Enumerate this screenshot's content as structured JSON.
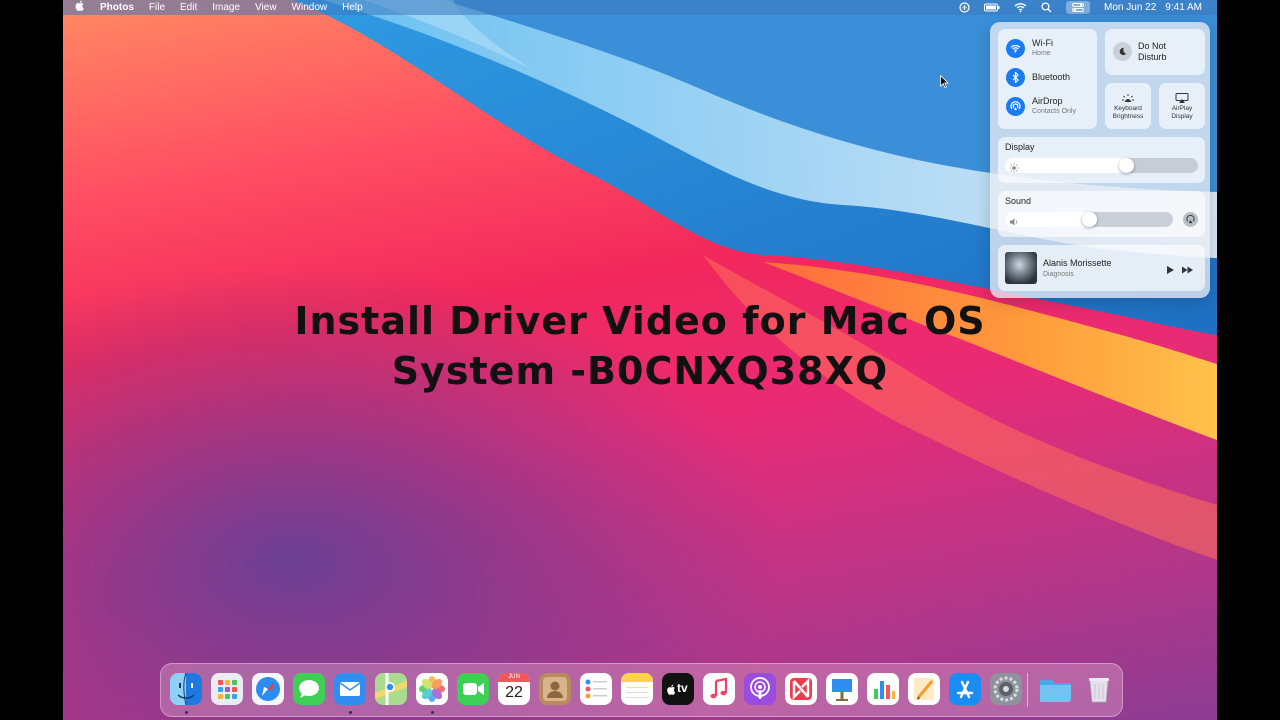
{
  "menubar": {
    "app_name": "Photos",
    "menus": [
      "File",
      "Edit",
      "Image",
      "View",
      "Window",
      "Help"
    ],
    "date": "Mon Jun 22",
    "time": "9:41 AM",
    "icons": [
      "apple-icon",
      "siri-icon",
      "battery-icon",
      "wifi-icon",
      "search-icon",
      "control-center-icon"
    ]
  },
  "overlay_title": {
    "line1": "Install Driver Video for Mac OS",
    "line2": "System -B0CNXQ38XQ"
  },
  "control_center": {
    "wifi": {
      "label": "Wi-Fi",
      "sub": "Home"
    },
    "bluetooth": {
      "label": "Bluetooth"
    },
    "airdrop": {
      "label": "AirDrop",
      "sub": "Contacts Only"
    },
    "dnd": {
      "line1": "Do Not",
      "line2": "Disturb"
    },
    "keyboard_brightness": {
      "line1": "Keyboard",
      "line2": "Brightness"
    },
    "airplay_display": {
      "line1": "AirPlay",
      "line2": "Display"
    },
    "display": {
      "label": "Display",
      "level": 0.67
    },
    "sound": {
      "label": "Sound",
      "level": 0.55
    },
    "now_playing": {
      "artist": "Alanis Morissette",
      "track": "Diagnosis"
    }
  },
  "dock": {
    "calendar": {
      "month": "JUN",
      "day": "22"
    },
    "tv_label": "tv",
    "apps": [
      "finder",
      "launchpad",
      "safari",
      "messages",
      "mail",
      "maps",
      "photos",
      "facetime",
      "calendar",
      "contacts",
      "reminders",
      "notes",
      "tv",
      "music",
      "podcasts",
      "news",
      "keynote",
      "numbers",
      "pages",
      "app-store",
      "system-preferences",
      "downloads-folder",
      "trash"
    ],
    "running": [
      "finder",
      "mail",
      "photos"
    ]
  },
  "colors": {
    "accent": "#1a7cf0"
  }
}
